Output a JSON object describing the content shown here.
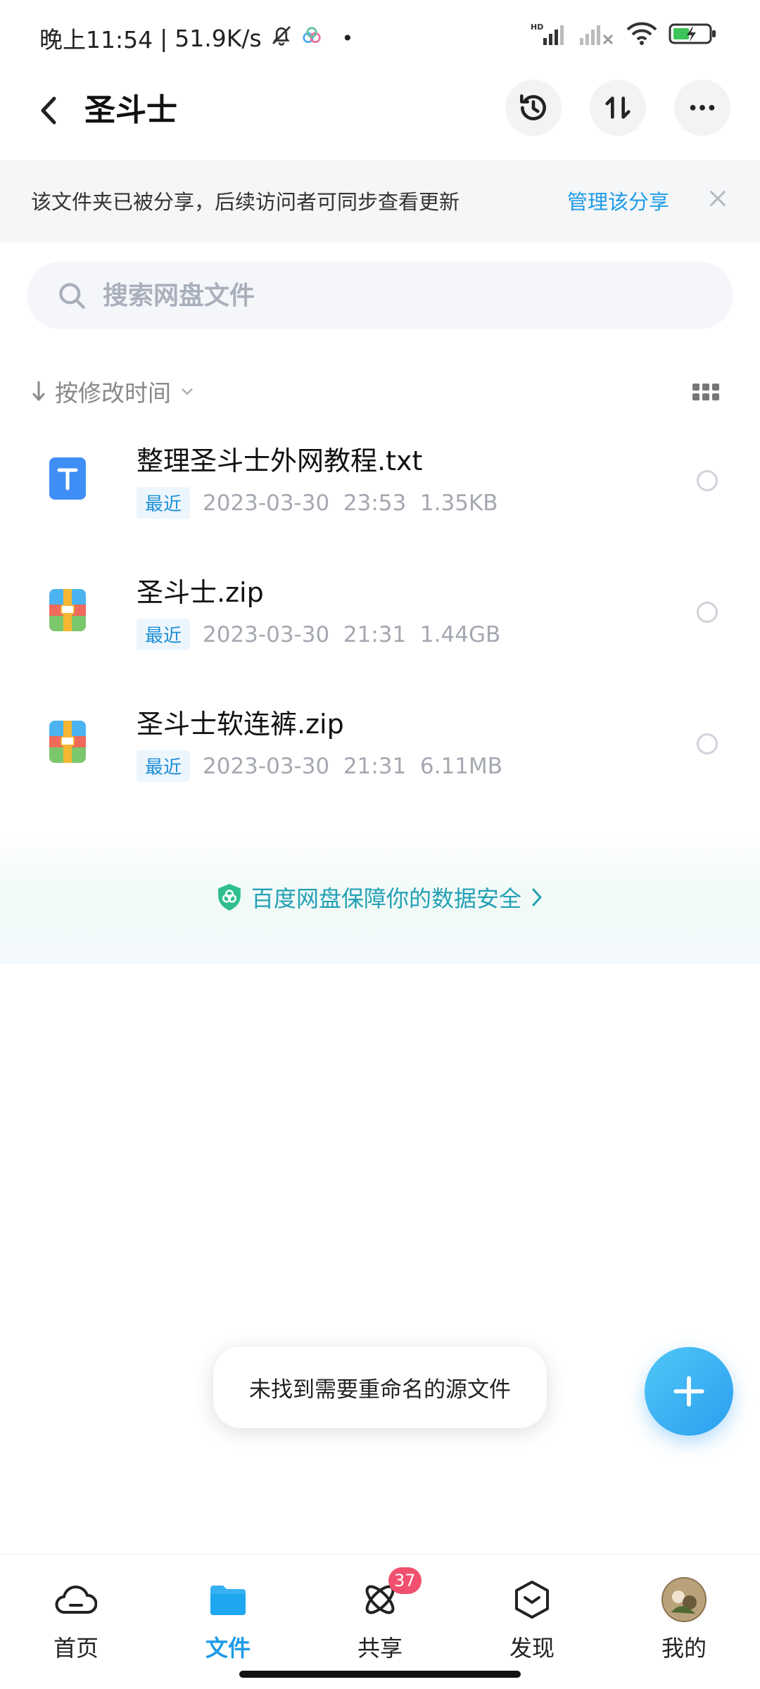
{
  "status_bar": {
    "time": "晚上11:54",
    "network_speed": "51.9K/s",
    "icons": [
      "bell-muted-icon",
      "baidu-netdisk-icon",
      "dot-icon",
      "signal-hd-icon",
      "signal-no-service-icon",
      "wifi-icon",
      "battery-charging-icon"
    ]
  },
  "header": {
    "title": "圣斗士",
    "icons": [
      "back-arrow-icon",
      "history-icon",
      "transfer-icon",
      "more-icon"
    ]
  },
  "share_banner": {
    "text": "该文件夹已被分享，后续访问者可同步查看更新",
    "action": "管理该分享"
  },
  "search": {
    "placeholder": "搜索网盘文件"
  },
  "sort": {
    "label": "按修改时间"
  },
  "files": [
    {
      "name": "整理圣斗士外网教程.txt",
      "badge": "最近",
      "meta": "2023-03-30  23:53  1.35KB",
      "icon": "txt-file-icon"
    },
    {
      "name": "圣斗士.zip",
      "badge": "最近",
      "meta": "2023-03-30  21:31  1.44GB",
      "icon": "zip-file-icon"
    },
    {
      "name": "圣斗士软连裤.zip",
      "badge": "最近",
      "meta": "2023-03-30  21:31  6.11MB",
      "icon": "zip-file-icon"
    }
  ],
  "security_banner": {
    "text": "百度网盘保障你的数据安全"
  },
  "toast": {
    "text": "未找到需要重命名的源文件"
  },
  "bottom_nav": {
    "items": [
      {
        "label": "首页",
        "icon": "home-cloud-icon"
      },
      {
        "label": "文件",
        "icon": "folder-icon",
        "active": true
      },
      {
        "label": "共享",
        "icon": "share-atom-icon",
        "badge": "37"
      },
      {
        "label": "发现",
        "icon": "discover-box-icon"
      },
      {
        "label": "我的",
        "icon": "avatar"
      }
    ]
  },
  "colors": {
    "accent": "#1e9be8",
    "badge_red": "#f0506e",
    "security_teal": "#23a0b5"
  }
}
